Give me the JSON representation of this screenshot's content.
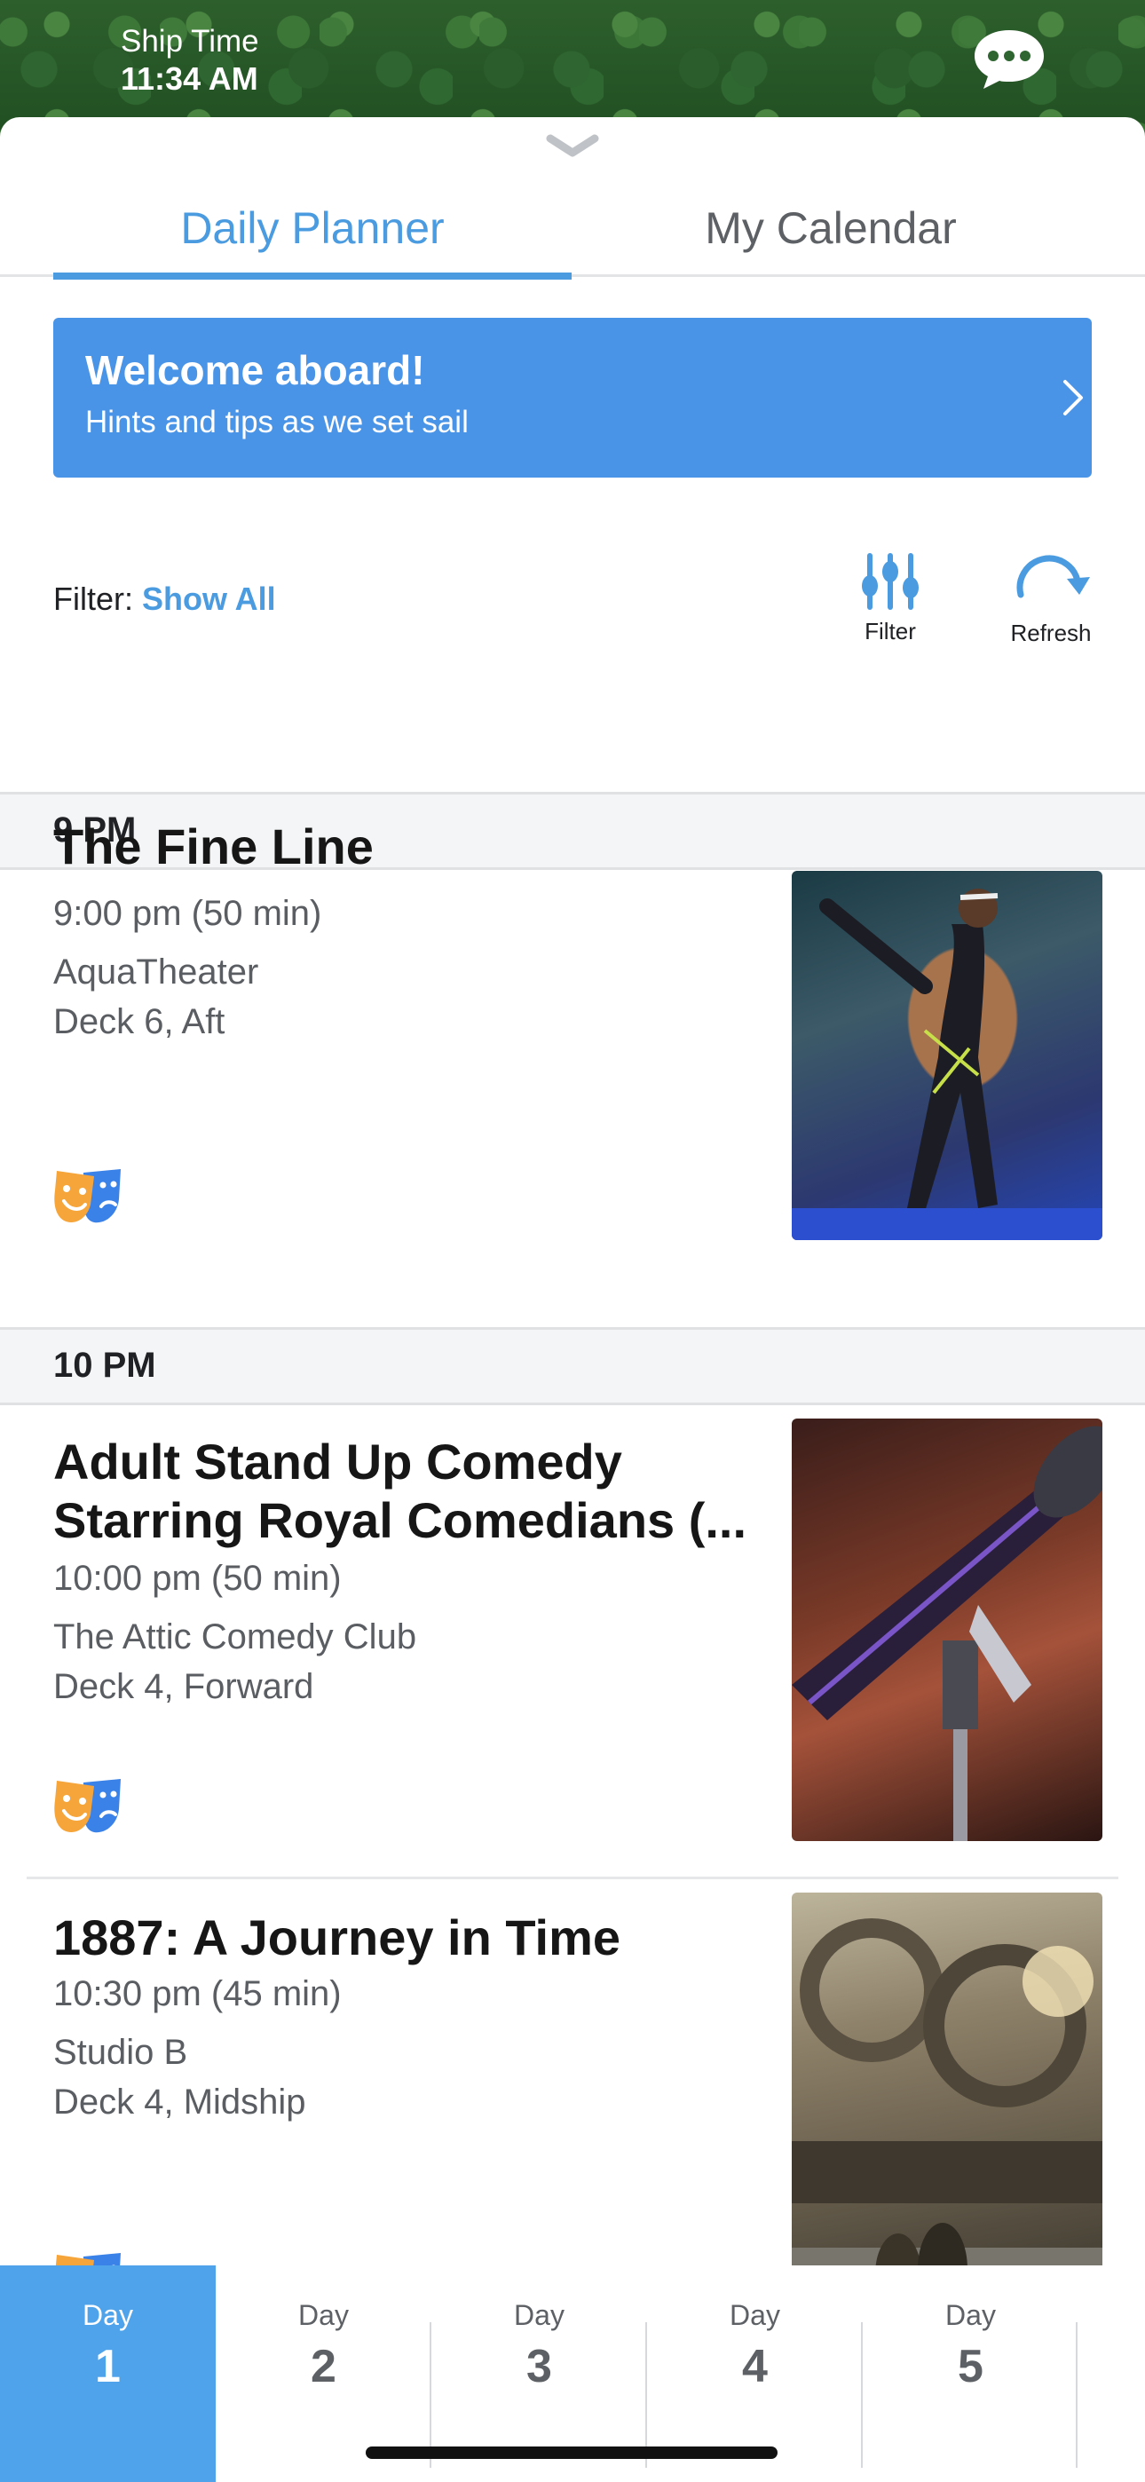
{
  "header": {
    "ship_time_label": "Ship Time",
    "ship_time_value": "11:34 AM"
  },
  "tabs": [
    {
      "label": "Daily Planner",
      "active": true
    },
    {
      "label": "My Calendar",
      "active": false
    }
  ],
  "welcome": {
    "title": "Welcome aboard!",
    "subtitle": "Hints and tips as we set sail"
  },
  "filter": {
    "prefix": "Filter:",
    "value": "Show All",
    "filter_label": "Filter",
    "refresh_label": "Refresh"
  },
  "schedule": [
    {
      "hour": "9 PM",
      "events": [
        {
          "title": "The Fine Line",
          "time": "9:00 pm (50 min)",
          "venue": "AquaTheater",
          "deck": "Deck 6, Aft",
          "icon": "theater-masks-icon"
        }
      ]
    },
    {
      "hour": "10 PM",
      "events": [
        {
          "title": "Adult Stand Up Comedy Starring Royal Comedians (...",
          "time": "10:00 pm (50 min)",
          "venue": "The Attic Comedy Club",
          "deck": "Deck 4, Forward",
          "icon": "theater-masks-icon"
        },
        {
          "title": "1887: A Journey in Time",
          "time": "10:30 pm (45 min)",
          "venue": "Studio B",
          "deck": "Deck 4, Midship",
          "icon": "theater-masks-icon"
        }
      ]
    }
  ],
  "days": [
    {
      "label": "Day",
      "number": "1",
      "active": true
    },
    {
      "label": "Day",
      "number": "2",
      "active": false
    },
    {
      "label": "Day",
      "number": "3",
      "active": false
    },
    {
      "label": "Day",
      "number": "4",
      "active": false
    },
    {
      "label": "Day",
      "number": "5",
      "active": false
    }
  ],
  "colors": {
    "accent": "#4a9be0",
    "welcome_banner": "#4a94e8",
    "active_day": "#4fa3ea"
  }
}
